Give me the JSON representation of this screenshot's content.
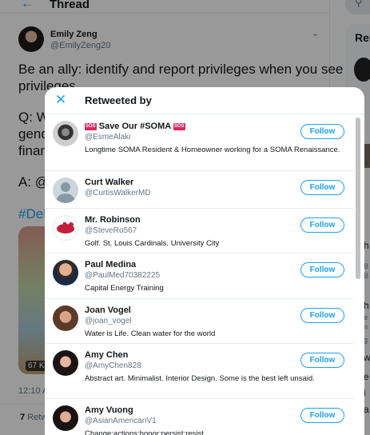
{
  "page": {
    "header_title": "Thread",
    "side_title": "Rel",
    "tweet": {
      "author_name": "Emily Zeng",
      "author_handle": "@EmilyZeng20",
      "text_lines": [
        "Be an ally: identify and report privileges when you see",
        "privileges.",
        "Q: W",
        "gend",
        "finan",
        "A: @",
        "#DeB"
      ],
      "image_size": "67 K",
      "time": "12:10 A",
      "retweet_count": "7",
      "retweet_label": "Retw"
    },
    "side_letters": [
      "h",
      "B",
      "B",
      "h",
      "e",
      "n",
      "g",
      "w",
      "e",
      "i",
      "a"
    ]
  },
  "modal": {
    "title": "Retweeted by",
    "users": [
      {
        "name_prefix_badge": "SOS",
        "name": "Save Our #SOMA",
        "name_suffix_badge": "SOS",
        "handle": "@EsmeAlaki",
        "bio": "Longtime SOMA Resident & Homeowner working for a SOMA Renaissance.",
        "button": "Follow",
        "avatar": "bw-photo-icon"
      },
      {
        "name": "Curt Walker",
        "handle": "@CurtisWalkerMD",
        "bio": "",
        "button": "Follow",
        "avatar": "default-avatar-icon"
      },
      {
        "name": "Mr. Robinson",
        "handle": "@SteveRo567",
        "bio": "Golf. St. Louis Cardinals. University City",
        "button": "Follow",
        "avatar": "cardinals-logo-icon"
      },
      {
        "name": "Paul Medina",
        "handle": "@PaulMed70382225",
        "bio": "Capital Energy Training",
        "button": "Follow",
        "avatar": "man-portrait-icon"
      },
      {
        "name": "Joan Vogel",
        "handle": "@joan_vogel",
        "bio": "Water is Life. Clean water for the world",
        "button": "Follow",
        "avatar": "woman-portrait-icon"
      },
      {
        "name": "Amy Chen",
        "handle": "@AmyChen828",
        "bio": "Abstract art. Minimalist. Interior Design. Some is the best left unsaid.",
        "button": "Follow",
        "avatar": "woman-portrait-icon"
      },
      {
        "name": "Amy Vuong",
        "handle": "@AsianAmericanV1",
        "bio": "Change:actions:honor:persist:resist",
        "button": "Follow",
        "avatar": "woman-portrait-icon"
      }
    ]
  },
  "colors": {
    "accent": "#1da1f2",
    "badge": "#e0245e",
    "text": "#14171a",
    "muted": "#657786"
  }
}
